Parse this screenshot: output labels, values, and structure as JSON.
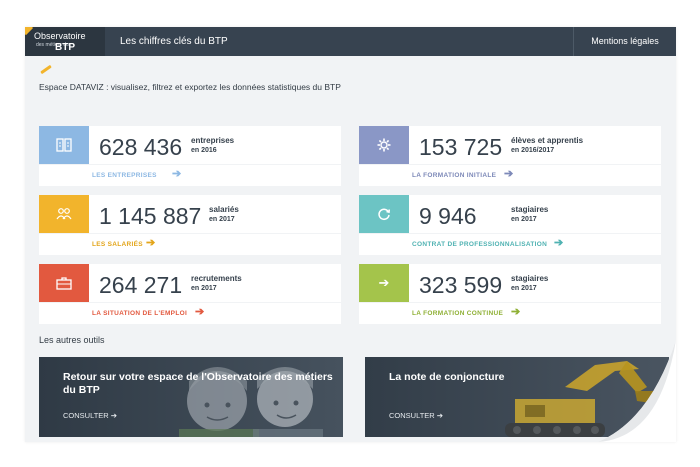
{
  "colors": {
    "header_bg": "#374350",
    "entreprises": "#8db8e3",
    "salaries": "#f2b42c",
    "recrutements": "#e2593f",
    "eleves": "#8a97c6",
    "stagiaires_pro": "#6cc4c4",
    "stagiaires_continue": "#a4c44b"
  },
  "header": {
    "logo_line1": "Observatoire",
    "logo_line2": "des métiers du",
    "logo_line3": "BTP",
    "title": "Les chiffres clés du BTP",
    "legal": "Mentions légales"
  },
  "intro": "Espace DATAVIZ : visualisez, filtrez et exportez les données statistiques du BTP",
  "cards": [
    {
      "icon": "building-icon",
      "value": "628 436",
      "label": "entreprises",
      "sub": "en 2016",
      "link": "LES ENTREPRISES"
    },
    {
      "icon": "people-icon",
      "value": "1 145 887",
      "label": "salariés",
      "sub": "en 2017",
      "link": "LES SALARIÉS"
    },
    {
      "icon": "briefcase-icon",
      "value": "264 271",
      "label": "recrutements",
      "sub": "en 2017",
      "link": "LA SITUATION DE L'EMPLOI"
    },
    {
      "icon": "gear-icon",
      "value": "153 725",
      "label": "élèves et apprentis",
      "sub": "en 2016/2017",
      "link": "LA FORMATION INITIALE"
    },
    {
      "icon": "cycle-icon",
      "value": "9 946",
      "label": "stagiaires",
      "sub": "en 2017",
      "link": "CONTRAT DE PROFESSIONNALISATION"
    },
    {
      "icon": "arrow-right-icon",
      "value": "323 599",
      "label": "stagiaires",
      "sub": "en 2017",
      "link": "LA FORMATION CONTINUE"
    }
  ],
  "others_title": "Les autres outils",
  "promos": [
    {
      "title": "Retour sur votre espace de l'Observatoire des métiers du BTP",
      "cta": "CONSULTER ➔"
    },
    {
      "title": "La note de conjoncture",
      "cta": "CONSULTER ➔"
    }
  ]
}
